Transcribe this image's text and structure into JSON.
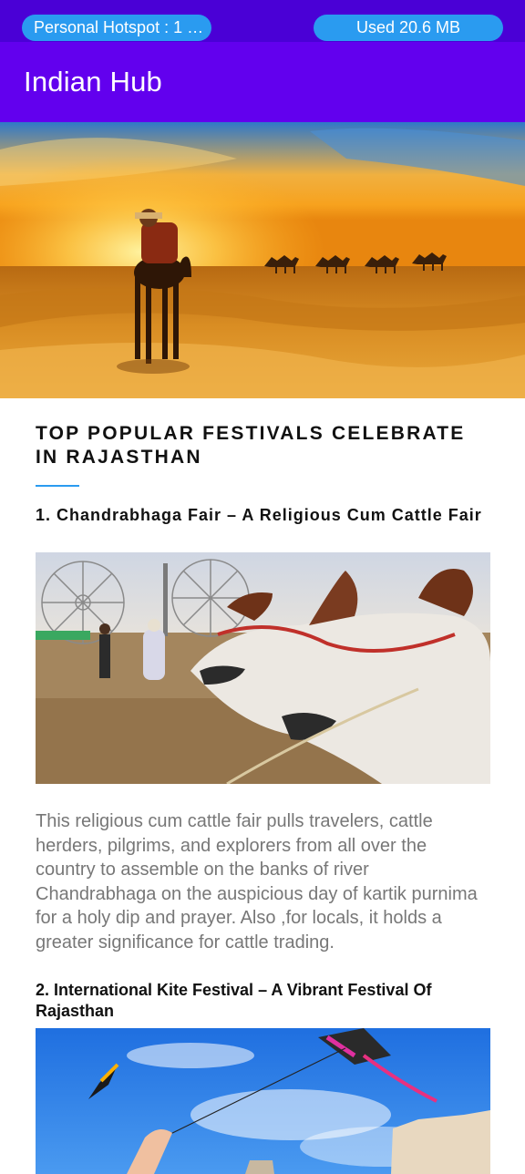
{
  "status_bar": {
    "hotspot_label": "Personal Hotspot : 1 …",
    "data_used_label": "Used  20.6 MB"
  },
  "app_bar": {
    "title": "Indian Hub"
  },
  "article": {
    "title": "TOP POPULAR FESTIVALS CELEBRATE IN RAJASTHAN",
    "festivals": [
      {
        "heading": "1. Chandrabhaga Fair – A Religious Cum Cattle Fair",
        "description": "This religious cum cattle fair pulls travelers, cattle herders, pilgrims, and explorers from all over the country to assemble on the banks of river Chandrabhaga on the auspicious day of kartik purnima for a holy dip and prayer. Also ,for locals, it holds a greater significance for cattle trading."
      },
      {
        "heading": "2. International Kite Festival – A Vibrant Festival Of Rajasthan"
      }
    ]
  },
  "colors": {
    "status_bar": "#4a00d6",
    "app_bar": "#6200ee",
    "pill": "#2a9bf0",
    "accent_underline": "#2a9bf0",
    "body_text": "#777777"
  }
}
